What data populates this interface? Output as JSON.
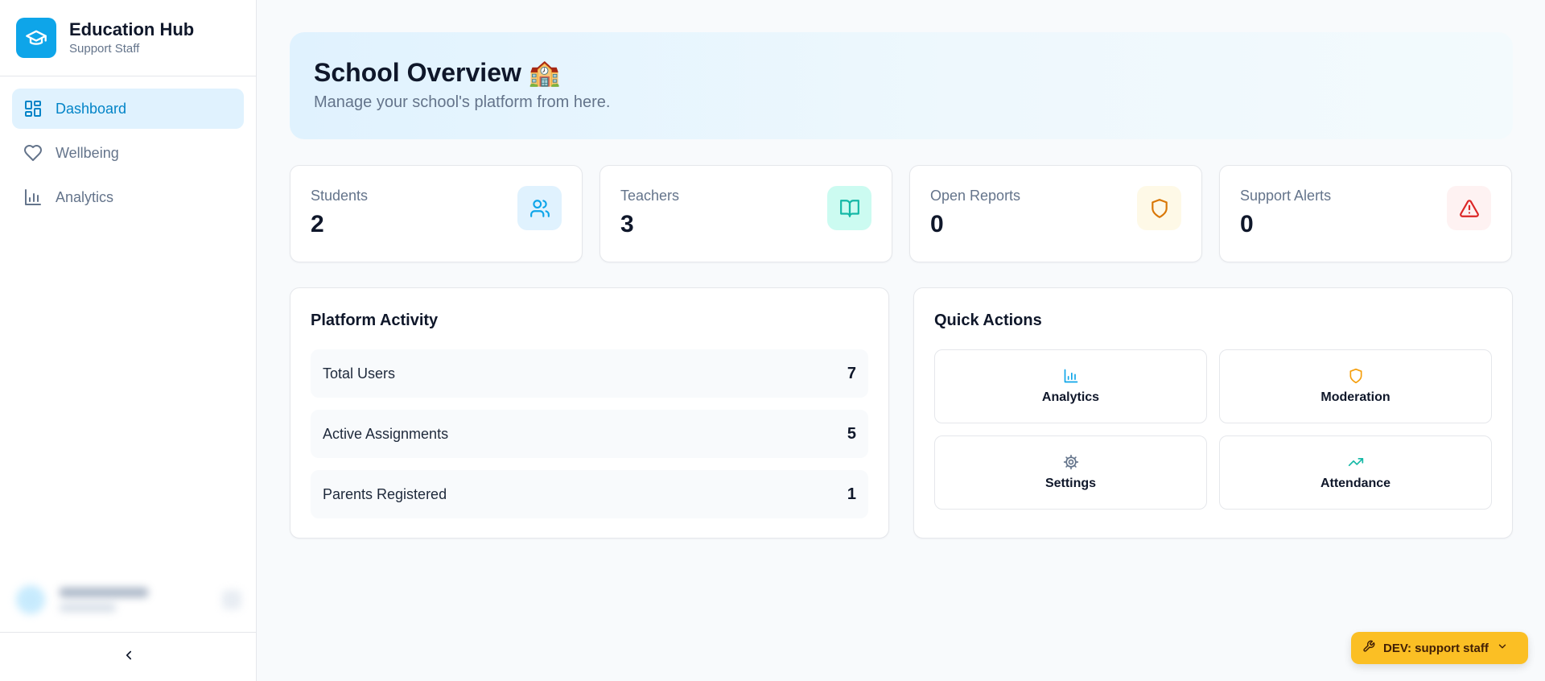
{
  "brand": {
    "title": "Education Hub",
    "subtitle": "Support Staff",
    "logo_icon": "graduation-cap-icon",
    "color": "#0ea5e9"
  },
  "nav": {
    "items": [
      {
        "label": "Dashboard",
        "icon": "layout-dashboard-icon",
        "active": true
      },
      {
        "label": "Wellbeing",
        "icon": "heart-icon",
        "active": false
      },
      {
        "label": "Analytics",
        "icon": "bar-chart-icon",
        "active": false
      }
    ],
    "collapse_icon": "chevron-left-icon"
  },
  "hero": {
    "title": "School Overview 🏫",
    "subtitle": "Manage your school's platform from here."
  },
  "stats": [
    {
      "label": "Students",
      "value": "2",
      "icon": "users-icon",
      "color": "#0ea5e9",
      "bg": "#e0f2fe"
    },
    {
      "label": "Teachers",
      "value": "3",
      "icon": "book-open-icon",
      "color": "#14b8a6",
      "bg": "#ccfbf1"
    },
    {
      "label": "Open Reports",
      "value": "0",
      "icon": "shield-icon",
      "color": "#d97706",
      "bg": "#fef9e7"
    },
    {
      "label": "Support Alerts",
      "value": "0",
      "icon": "alert-triangle-icon",
      "color": "#dc2626",
      "bg": "#fef2f2"
    }
  ],
  "activity": {
    "title": "Platform Activity",
    "rows": [
      {
        "label": "Total Users",
        "value": "7"
      },
      {
        "label": "Active Assignments",
        "value": "5"
      },
      {
        "label": "Parents Registered",
        "value": "1"
      }
    ]
  },
  "quick_actions": {
    "title": "Quick Actions",
    "items": [
      {
        "label": "Analytics",
        "icon": "bar-chart-icon",
        "color": "#0ea5e9"
      },
      {
        "label": "Moderation",
        "icon": "shield-icon",
        "color": "#f59e0b"
      },
      {
        "label": "Settings",
        "icon": "gear-icon",
        "color": "#64748b"
      },
      {
        "label": "Attendance",
        "icon": "trending-up-icon",
        "color": "#14b8a6"
      }
    ]
  },
  "dev_badge": {
    "label": "DEV: support staff",
    "icon": "wrench-icon",
    "color": "#fbbf24"
  }
}
